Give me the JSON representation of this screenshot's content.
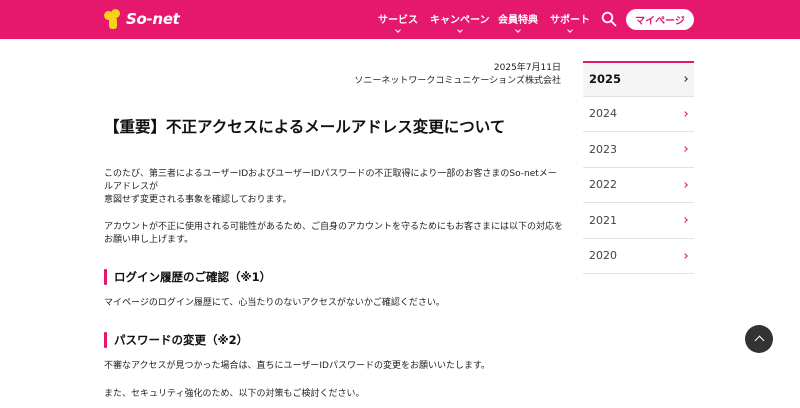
{
  "header": {
    "logo_text": "So-net",
    "nav": [
      "サービス",
      "キャンペーン",
      "会員特典",
      "サポート"
    ],
    "mypage_label": "マイページ"
  },
  "article": {
    "date": "2025年7月11日",
    "company": "ソニーネットワークコミュニケーションズ株式会社",
    "title": "【重要】不正アクセスによるメールアドレス変更について",
    "para1": "このたび、第三者によるユーザーIDおよびユーザーIDパスワードの不正取得により一部のお客さまのSo-netメールアドレスが\n意図せず変更される事象を確認しております。",
    "para2": "アカウントが不正に使用される可能性があるため、ご自身のアカウントを守るためにもお客さまには以下の対応を\nお願い申し上げます。",
    "section1_title": "ログイン履歴のご確認（※1）",
    "section1_text": "マイページのログイン履歴にて、心当たりのないアクセスがないかご確認ください。",
    "section2_title": "パスワードの変更（※2）",
    "section2_text": "不審なアクセスが見つかった場合は、直ちにユーザーIDパスワードの変更をお願いいたします。",
    "para3": "また、セキュリティ強化のため、以下の対策もご検討ください。"
  },
  "sidebar": {
    "years": [
      "2025",
      "2024",
      "2023",
      "2022",
      "2021",
      "2020"
    ],
    "active_year": "2025"
  },
  "colors": {
    "brand": "#e6186e",
    "logo_yellow": "#f7d21a"
  },
  "icons": {
    "search": "search-icon",
    "back_to_top": "arrow-up-icon",
    "chevron": "chevron-down-icon",
    "arrow": "chevron-right-icon"
  }
}
